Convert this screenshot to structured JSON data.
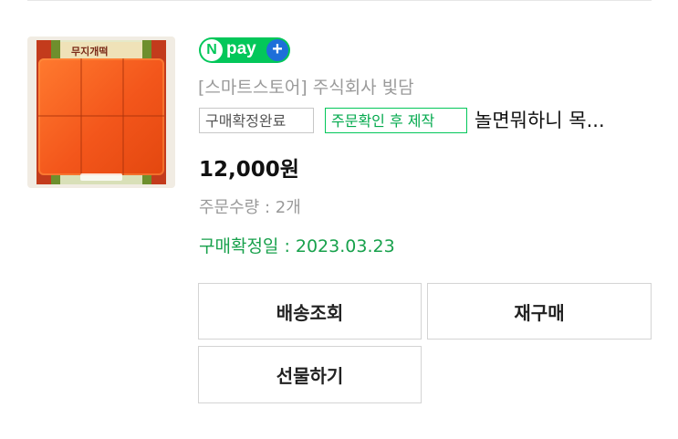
{
  "order": {
    "payment_badge": {
      "n_letter": "N",
      "pay_text": "pay",
      "plus_symbol": "+"
    },
    "store_name": "[스마트스토어] 주식회사 빛담",
    "status_badge": "구매확정완료",
    "made_to_order_badge": "주문확인 후 제작",
    "product_title": "놀면뭐하니 목...",
    "price": "12,000원",
    "quantity": "주문수량 : 2개",
    "confirmed_date": "구매확정일 : 2023.03.23",
    "thumbnail_package_text": "무지개떡"
  },
  "actions": {
    "track_shipping": "배송조회",
    "reorder": "재구매",
    "send_gift": "선물하기"
  },
  "colors": {
    "naver_green": "#03c75a",
    "confirm_green": "#18a14c",
    "plus_blue": "#1e6fd9",
    "muted_gray": "#9a9a9a"
  }
}
